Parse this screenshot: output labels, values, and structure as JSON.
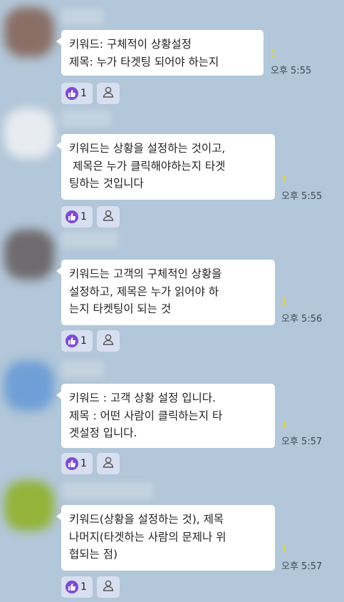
{
  "colors": {
    "background": "#b2c7d9",
    "bubble": "#ffffff",
    "unread": "#f4d400",
    "reaction_accent": "#7d4bd3",
    "reaction_bg": "#d7dff0"
  },
  "messages": [
    {
      "text": "키워드: 구체적이 상황설정\n제목: 누가 타겟팅 되어야 하는지",
      "unread": "1",
      "time": "오후 5:55",
      "reaction_count": "1",
      "avatar_color": "#8a6f66"
    },
    {
      "text": "키워드는 상황을 설정하는 것이고,\n 제목은 누가 클릭해야하는지 타겟\n팅하는 것입니다",
      "unread": "1",
      "time": "오후 5:55",
      "reaction_count": "1",
      "avatar_color": "#e8ecf2"
    },
    {
      "text": "키워드는 고객의 구체적인 상황을\n설정하고, 제목은 누가 읽어야 하\n는지 타켓팅이 되는 것",
      "unread": "1",
      "time": "오후 5:56",
      "reaction_count": "1",
      "avatar_color": "#6f6a6d"
    },
    {
      "text": "키워드 : 고객 상황 설정 입니다.\n제목 : 어떤 사람이 클릭하는지 타\n겟설정 입니다.",
      "unread": "1",
      "time": "오후 5:57",
      "reaction_count": "1",
      "avatar_color": "#6f9fd6"
    },
    {
      "text": "키워드(상황을 설정하는 것), 제목\n나머지(타겟하는 사람의 문제나 위\n협되는 점)",
      "unread": "1",
      "time": "오후 5:57",
      "reaction_count": "1",
      "avatar_color": "#93b33a"
    }
  ]
}
